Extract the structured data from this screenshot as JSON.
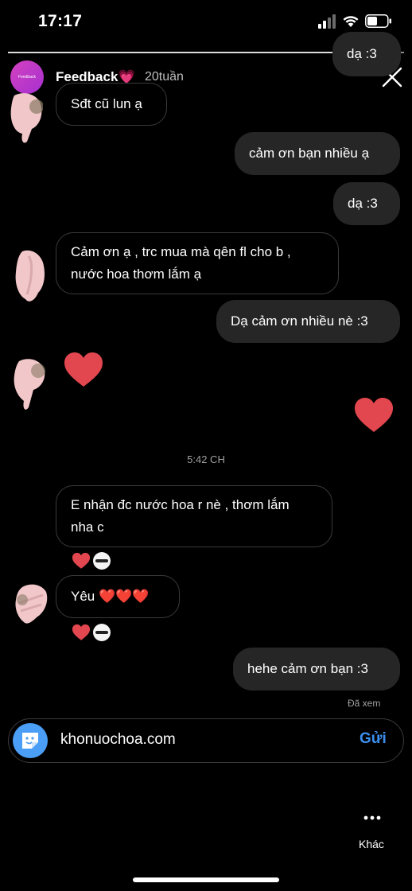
{
  "status_bar": {
    "time": "17:17"
  },
  "story": {
    "name": "Feedback",
    "name_emoji": "💗",
    "time": "20tuần",
    "avatar_text": "Feedback",
    "progress": 0.83
  },
  "messages": {
    "top_partial": "dạ :3",
    "m1": "Sđt cũ lun ạ",
    "m2": "cảm ơn bạn nhiều ạ",
    "m3": "dạ :3",
    "m4_line1": "Cảm ơn ạ , trc mua mà qên fl cho b ,",
    "m4_line2": "nước hoa thơm lắm ạ",
    "m5": "Dạ cảm ơn nhiều nè :3",
    "time_separator": "5:42 CH",
    "m8_line1": "E nhận đc nước hoa r nè , thơm lắm",
    "m8_line2": "nha c",
    "m9": "Yêu ❤️❤️❤️",
    "m10": "hehe cảm ơn bạn :3",
    "seen": "Đã xem"
  },
  "composer": {
    "text": "khonuochoa.com",
    "send": "Gửi"
  },
  "bottom": {
    "more_label": "Khác"
  },
  "colors": {
    "heart": "#e2464f",
    "send": "#3b8ff0",
    "story_avatar": "#c43dcc"
  }
}
